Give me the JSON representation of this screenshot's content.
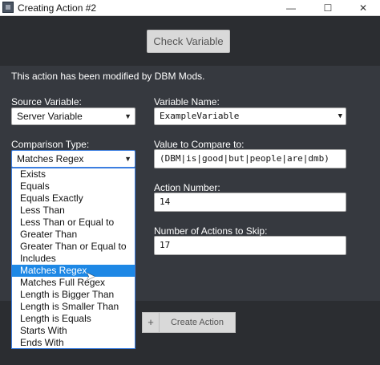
{
  "window": {
    "title": "Creating Action #2",
    "minimize": "—",
    "maximize": "☐",
    "close": "✕"
  },
  "toolbar": {
    "check_variable": "Check Variable"
  },
  "note": "This action has been modified by DBM Mods.",
  "source_variable": {
    "label": "Source Variable:",
    "value": "Server Variable"
  },
  "variable_name": {
    "label": "Variable Name:",
    "value": "ExampleVariable"
  },
  "comparison_type": {
    "label": "Comparison Type:",
    "value": "Matches Regex",
    "options": [
      "Exists",
      "Equals",
      "Equals Exactly",
      "Less Than",
      "Less Than or Equal to",
      "Greater Than",
      "Greater Than or Equal to",
      "Includes",
      "Matches Regex",
      "Matches Full Regex",
      "Length is Bigger Than",
      "Length is Smaller Than",
      "Length is Equals",
      "Starts With",
      "Ends With"
    ],
    "selected_index": 8
  },
  "value_compare": {
    "label": "Value to Compare to:",
    "value": "(DBM|is|good|but|people|are|dmb)"
  },
  "action_number": {
    "label": "Action Number:",
    "value": "14"
  },
  "actions_to_skip": {
    "label": "Number of Actions to Skip:",
    "value": "17"
  },
  "bottom": {
    "plus": "+",
    "create_action": "Create Action"
  },
  "icons": {
    "app": "app-icon",
    "dropdown": "chevron-down-icon",
    "cursor": "mouse-pointer-icon"
  },
  "colors": {
    "selection": "#1e88e5",
    "panel": "#36393f",
    "dark": "#2b2d31"
  }
}
